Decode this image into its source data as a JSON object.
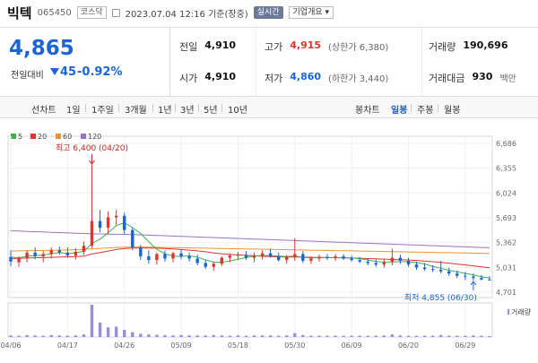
{
  "header": {
    "name": "빅텍",
    "code": "065450",
    "market": "코스닥",
    "timestamp": "2023.07.04 12:16 기준(장중)",
    "realtime_label": "실시간",
    "overview_label": "기업개요 ▾"
  },
  "summary": {
    "price": "4,865",
    "change_label": "전일대비",
    "change_value": "45",
    "change_pct": "-0.92%",
    "prev_close": {
      "label": "전일",
      "value": "4,910"
    },
    "open": {
      "label": "시가",
      "value": "4,910"
    },
    "high": {
      "label": "고가",
      "value": "4,915",
      "sub": "(상한가 6,380)"
    },
    "low": {
      "label": "저가",
      "value": "4,860",
      "sub": "(하한가 3,440)"
    },
    "volume": {
      "label": "거래량",
      "value": "190,696"
    },
    "amount": {
      "label": "거래대금",
      "value": "930",
      "unit": "백만"
    }
  },
  "tabs": {
    "line_chart": "선차트",
    "periods": [
      "1일",
      "1주일",
      "3개월",
      "1년",
      "3년",
      "5년",
      "10년"
    ],
    "candle_chart": "봉차트",
    "candle_periods": [
      "일봉",
      "주봉",
      "월봉"
    ],
    "active_candle": "일봉"
  },
  "chart_data": {
    "type": "candlestick",
    "legend": [
      {
        "name": "5",
        "color": "#3cb44b"
      },
      {
        "name": "20",
        "color": "#e0342f"
      },
      {
        "name": "60",
        "color": "#f0922b"
      },
      {
        "name": "120",
        "color": "#9b6fc8"
      }
    ],
    "ylim": [
      4701,
      6686
    ],
    "y_ticks": [
      6686,
      6355,
      6024,
      5693,
      5362,
      5031,
      4701
    ],
    "y_tick_labels": [
      "6,686",
      "6,355",
      "6,024",
      "5,693",
      "5,362",
      "5,031",
      "4,701"
    ],
    "x_tick_labels": [
      "04/06",
      "04/17",
      "04/26",
      "05/09",
      "05/18",
      "05/30",
      "06/09",
      "06/20",
      "06/29"
    ],
    "x_tick_index": [
      0,
      7,
      14,
      21,
      28,
      35,
      42,
      49,
      56
    ],
    "max_annotation": "최고 6,400 (04/20)",
    "max_index": 10,
    "max_value": 6400,
    "min_annotation": "최저 4,855 (06/30)",
    "min_index": 57,
    "min_value": 4855,
    "volume_label": "거래량",
    "candles": [
      {
        "o": 5170,
        "h": 5260,
        "l": 5050,
        "c": 5110
      },
      {
        "o": 5100,
        "h": 5180,
        "l": 5040,
        "c": 5150
      },
      {
        "o": 5150,
        "h": 5260,
        "l": 5100,
        "c": 5230
      },
      {
        "o": 5230,
        "h": 5300,
        "l": 5140,
        "c": 5180
      },
      {
        "o": 5180,
        "h": 5250,
        "l": 5100,
        "c": 5210
      },
      {
        "o": 5210,
        "h": 5300,
        "l": 5150,
        "c": 5260
      },
      {
        "o": 5260,
        "h": 5310,
        "l": 5200,
        "c": 5230
      },
      {
        "o": 5230,
        "h": 5300,
        "l": 5160,
        "c": 5190
      },
      {
        "o": 5190,
        "h": 5290,
        "l": 5140,
        "c": 5240
      },
      {
        "o": 5240,
        "h": 5380,
        "l": 5200,
        "c": 5320
      },
      {
        "o": 5320,
        "h": 6400,
        "l": 5290,
        "c": 5650
      },
      {
        "o": 5650,
        "h": 5800,
        "l": 5500,
        "c": 5560
      },
      {
        "o": 5560,
        "h": 5780,
        "l": 5480,
        "c": 5700
      },
      {
        "o": 5700,
        "h": 5800,
        "l": 5600,
        "c": 5720
      },
      {
        "o": 5720,
        "h": 5760,
        "l": 5480,
        "c": 5530
      },
      {
        "o": 5530,
        "h": 5560,
        "l": 5260,
        "c": 5300
      },
      {
        "o": 5300,
        "h": 5330,
        "l": 5130,
        "c": 5180
      },
      {
        "o": 5180,
        "h": 5260,
        "l": 5080,
        "c": 5130
      },
      {
        "o": 5130,
        "h": 5230,
        "l": 5070,
        "c": 5210
      },
      {
        "o": 5210,
        "h": 5260,
        "l": 5110,
        "c": 5150
      },
      {
        "o": 5150,
        "h": 5240,
        "l": 5100,
        "c": 5220
      },
      {
        "o": 5220,
        "h": 5270,
        "l": 5140,
        "c": 5180
      },
      {
        "o": 5180,
        "h": 5230,
        "l": 5110,
        "c": 5150
      },
      {
        "o": 5150,
        "h": 5200,
        "l": 5060,
        "c": 5090
      },
      {
        "o": 5090,
        "h": 5130,
        "l": 5010,
        "c": 5040
      },
      {
        "o": 5040,
        "h": 5110,
        "l": 4990,
        "c": 5080
      },
      {
        "o": 5080,
        "h": 5180,
        "l": 5050,
        "c": 5160
      },
      {
        "o": 5160,
        "h": 5220,
        "l": 5100,
        "c": 5190
      },
      {
        "o": 5190,
        "h": 5240,
        "l": 5130,
        "c": 5200
      },
      {
        "o": 5200,
        "h": 5250,
        "l": 5130,
        "c": 5160
      },
      {
        "o": 5160,
        "h": 5230,
        "l": 5100,
        "c": 5190
      },
      {
        "o": 5190,
        "h": 5260,
        "l": 5140,
        "c": 5220
      },
      {
        "o": 5220,
        "h": 5280,
        "l": 5160,
        "c": 5180
      },
      {
        "o": 5180,
        "h": 5230,
        "l": 5110,
        "c": 5130
      },
      {
        "o": 5130,
        "h": 5200,
        "l": 5080,
        "c": 5170
      },
      {
        "o": 5170,
        "h": 5420,
        "l": 5120,
        "c": 5210
      },
      {
        "o": 5210,
        "h": 5250,
        "l": 5090,
        "c": 5120
      },
      {
        "o": 5120,
        "h": 5180,
        "l": 5080,
        "c": 5150
      },
      {
        "o": 5150,
        "h": 5200,
        "l": 5110,
        "c": 5170
      },
      {
        "o": 5170,
        "h": 5210,
        "l": 5130,
        "c": 5160
      },
      {
        "o": 5160,
        "h": 5210,
        "l": 5120,
        "c": 5180
      },
      {
        "o": 5180,
        "h": 5210,
        "l": 5130,
        "c": 5150
      },
      {
        "o": 5150,
        "h": 5190,
        "l": 5110,
        "c": 5130
      },
      {
        "o": 5130,
        "h": 5170,
        "l": 5090,
        "c": 5110
      },
      {
        "o": 5110,
        "h": 5150,
        "l": 5060,
        "c": 5090
      },
      {
        "o": 5090,
        "h": 5140,
        "l": 5040,
        "c": 5070
      },
      {
        "o": 5070,
        "h": 5150,
        "l": 5030,
        "c": 5100
      },
      {
        "o": 5100,
        "h": 5280,
        "l": 5060,
        "c": 5160
      },
      {
        "o": 5160,
        "h": 5200,
        "l": 5080,
        "c": 5120
      },
      {
        "o": 5120,
        "h": 5160,
        "l": 5040,
        "c": 5070
      },
      {
        "o": 5070,
        "h": 5110,
        "l": 5000,
        "c": 5030
      },
      {
        "o": 5030,
        "h": 5090,
        "l": 4990,
        "c": 5010
      },
      {
        "o": 5010,
        "h": 5060,
        "l": 4970,
        "c": 5000
      },
      {
        "o": 5000,
        "h": 5120,
        "l": 4950,
        "c": 4980
      },
      {
        "o": 4980,
        "h": 5030,
        "l": 4920,
        "c": 4950
      },
      {
        "o": 4950,
        "h": 4990,
        "l": 4890,
        "c": 4920
      },
      {
        "o": 4920,
        "h": 4970,
        "l": 4860,
        "c": 4910
      },
      {
        "o": 4910,
        "h": 4950,
        "l": 4855,
        "c": 4890
      },
      {
        "o": 4890,
        "h": 4930,
        "l": 4860,
        "c": 4870
      },
      {
        "o": 4870,
        "h": 4915,
        "l": 4860,
        "c": 4865
      }
    ],
    "volume_rel": [
      0.05,
      0.04,
      0.06,
      0.05,
      0.04,
      0.06,
      0.05,
      0.04,
      0.05,
      0.08,
      1.0,
      0.45,
      0.3,
      0.32,
      0.22,
      0.15,
      0.1,
      0.08,
      0.07,
      0.06,
      0.05,
      0.06,
      0.05,
      0.05,
      0.05,
      0.06,
      0.05,
      0.04,
      0.05,
      0.04,
      0.05,
      0.05,
      0.05,
      0.04,
      0.05,
      0.12,
      0.06,
      0.04,
      0.04,
      0.04,
      0.04,
      0.04,
      0.04,
      0.04,
      0.04,
      0.04,
      0.05,
      0.08,
      0.05,
      0.04,
      0.04,
      0.04,
      0.04,
      0.06,
      0.04,
      0.04,
      0.04,
      0.05,
      0.04,
      0.03
    ],
    "ma5": [
      5170,
      5160,
      5180,
      5190,
      5196,
      5214,
      5230,
      5216,
      5226,
      5248,
      5352,
      5408,
      5494,
      5590,
      5628,
      5562,
      5486,
      5376,
      5272,
      5214,
      5182,
      5178,
      5186,
      5170,
      5132,
      5102,
      5100,
      5118,
      5140,
      5162,
      5184,
      5190,
      5190,
      5182,
      5176,
      5184,
      5166,
      5156,
      5164,
      5166,
      5160,
      5162,
      5158,
      5148,
      5132,
      5110,
      5102,
      5108,
      5108,
      5108,
      5096,
      5078,
      5046,
      5020,
      4994,
      4972,
      4952,
      4930,
      4908,
      4888
    ],
    "ma20": [
      5150,
      5152,
      5156,
      5160,
      5162,
      5166,
      5170,
      5172,
      5176,
      5182,
      5210,
      5230,
      5250,
      5270,
      5285,
      5290,
      5292,
      5290,
      5288,
      5284,
      5278,
      5270,
      5262,
      5252,
      5240,
      5226,
      5214,
      5205,
      5198,
      5192,
      5186,
      5180,
      5176,
      5172,
      5170,
      5170,
      5168,
      5166,
      5164,
      5162,
      5160,
      5158,
      5156,
      5154,
      5150,
      5146,
      5142,
      5138,
      5134,
      5130,
      5124,
      5116,
      5108,
      5098,
      5088,
      5076,
      5064,
      5052,
      5040,
      5028
    ],
    "ma60": [
      5250,
      5252,
      5254,
      5256,
      5258,
      5260,
      5262,
      5264,
      5268,
      5272,
      5280,
      5286,
      5292,
      5298,
      5302,
      5304,
      5304,
      5302,
      5300,
      5298,
      5296,
      5294,
      5292,
      5290,
      5288,
      5286,
      5284,
      5282,
      5280,
      5278,
      5276,
      5274,
      5272,
      5270,
      5268,
      5266,
      5264,
      5262,
      5260,
      5258,
      5256,
      5254,
      5252,
      5250,
      5248,
      5246,
      5244,
      5242,
      5240,
      5238,
      5236,
      5234,
      5232,
      5230,
      5228,
      5226,
      5224,
      5222,
      5220,
      5218
    ],
    "ma120": [
      5520,
      5516,
      5512,
      5508,
      5504,
      5500,
      5496,
      5492,
      5488,
      5484,
      5480,
      5478,
      5476,
      5474,
      5472,
      5470,
      5466,
      5462,
      5458,
      5454,
      5450,
      5446,
      5442,
      5438,
      5434,
      5430,
      5426,
      5422,
      5418,
      5414,
      5410,
      5406,
      5402,
      5398,
      5394,
      5390,
      5386,
      5382,
      5378,
      5374,
      5370,
      5366,
      5362,
      5358,
      5354,
      5350,
      5346,
      5342,
      5338,
      5334,
      5330,
      5326,
      5322,
      5318,
      5314,
      5310,
      5306,
      5302,
      5298,
      5294
    ]
  }
}
